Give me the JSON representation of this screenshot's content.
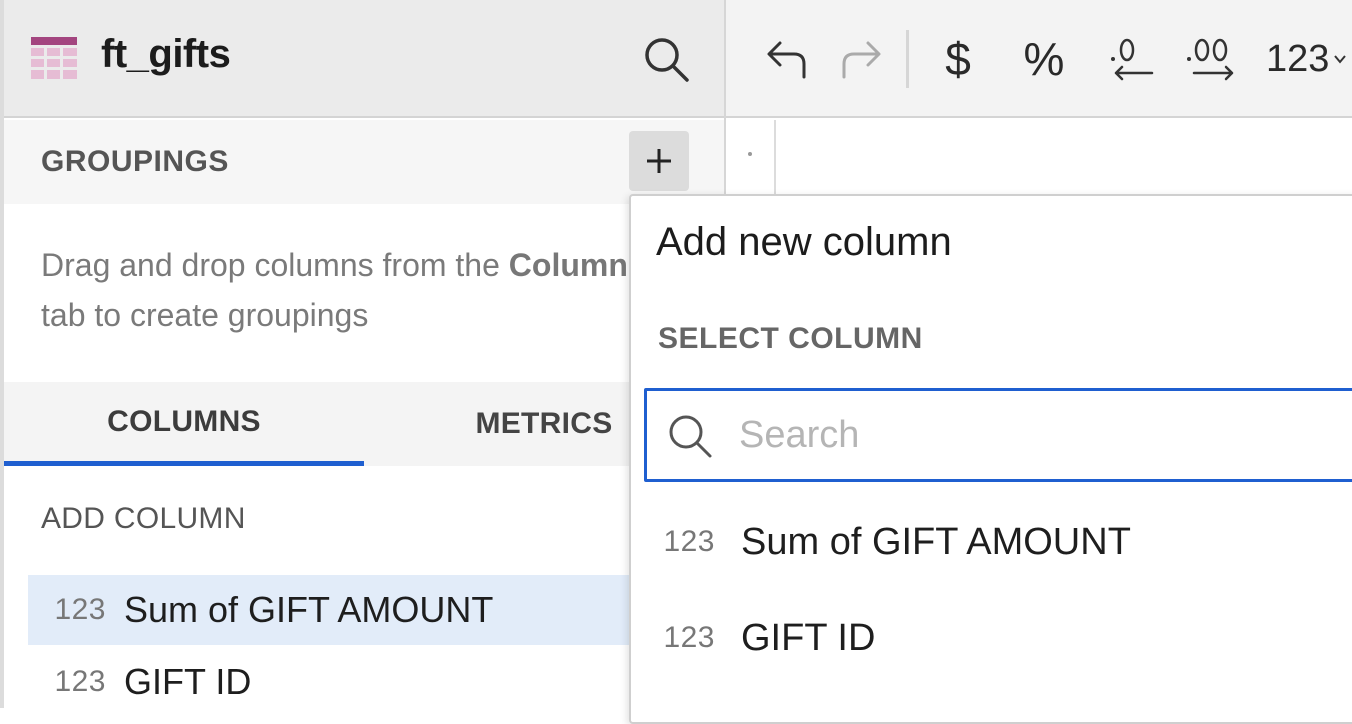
{
  "left_panel": {
    "title": "ft_gifts",
    "groupings": {
      "label": "GROUPINGS",
      "hint_part1": "Drag and drop columns from the ",
      "hint_bold": "Columns",
      "hint_part2": "tab to create groupings"
    },
    "tabs": [
      {
        "label": "COLUMNS",
        "active": true
      },
      {
        "label": "METRICS",
        "active": false
      }
    ],
    "add_column_label": "ADD COLUMN",
    "columns": [
      {
        "type": "123",
        "name": "Sum of GIFT AMOUNT",
        "selected": true
      },
      {
        "type": "123",
        "name": "GIFT ID",
        "selected": false
      }
    ]
  },
  "toolbar": {
    "currency": "$",
    "percent": "%",
    "number_format": "123"
  },
  "dropdown": {
    "title": "Add new column",
    "subtitle": "SELECT COLUMN",
    "search_placeholder": "Search",
    "options": [
      {
        "type": "123",
        "name": "Sum of GIFT AMOUNT"
      },
      {
        "type": "123",
        "name": "GIFT ID"
      }
    ]
  },
  "colors": {
    "accent": "#1f5fd0",
    "table_icon": "#a3457f",
    "selected_row": "#e2ecf9"
  }
}
